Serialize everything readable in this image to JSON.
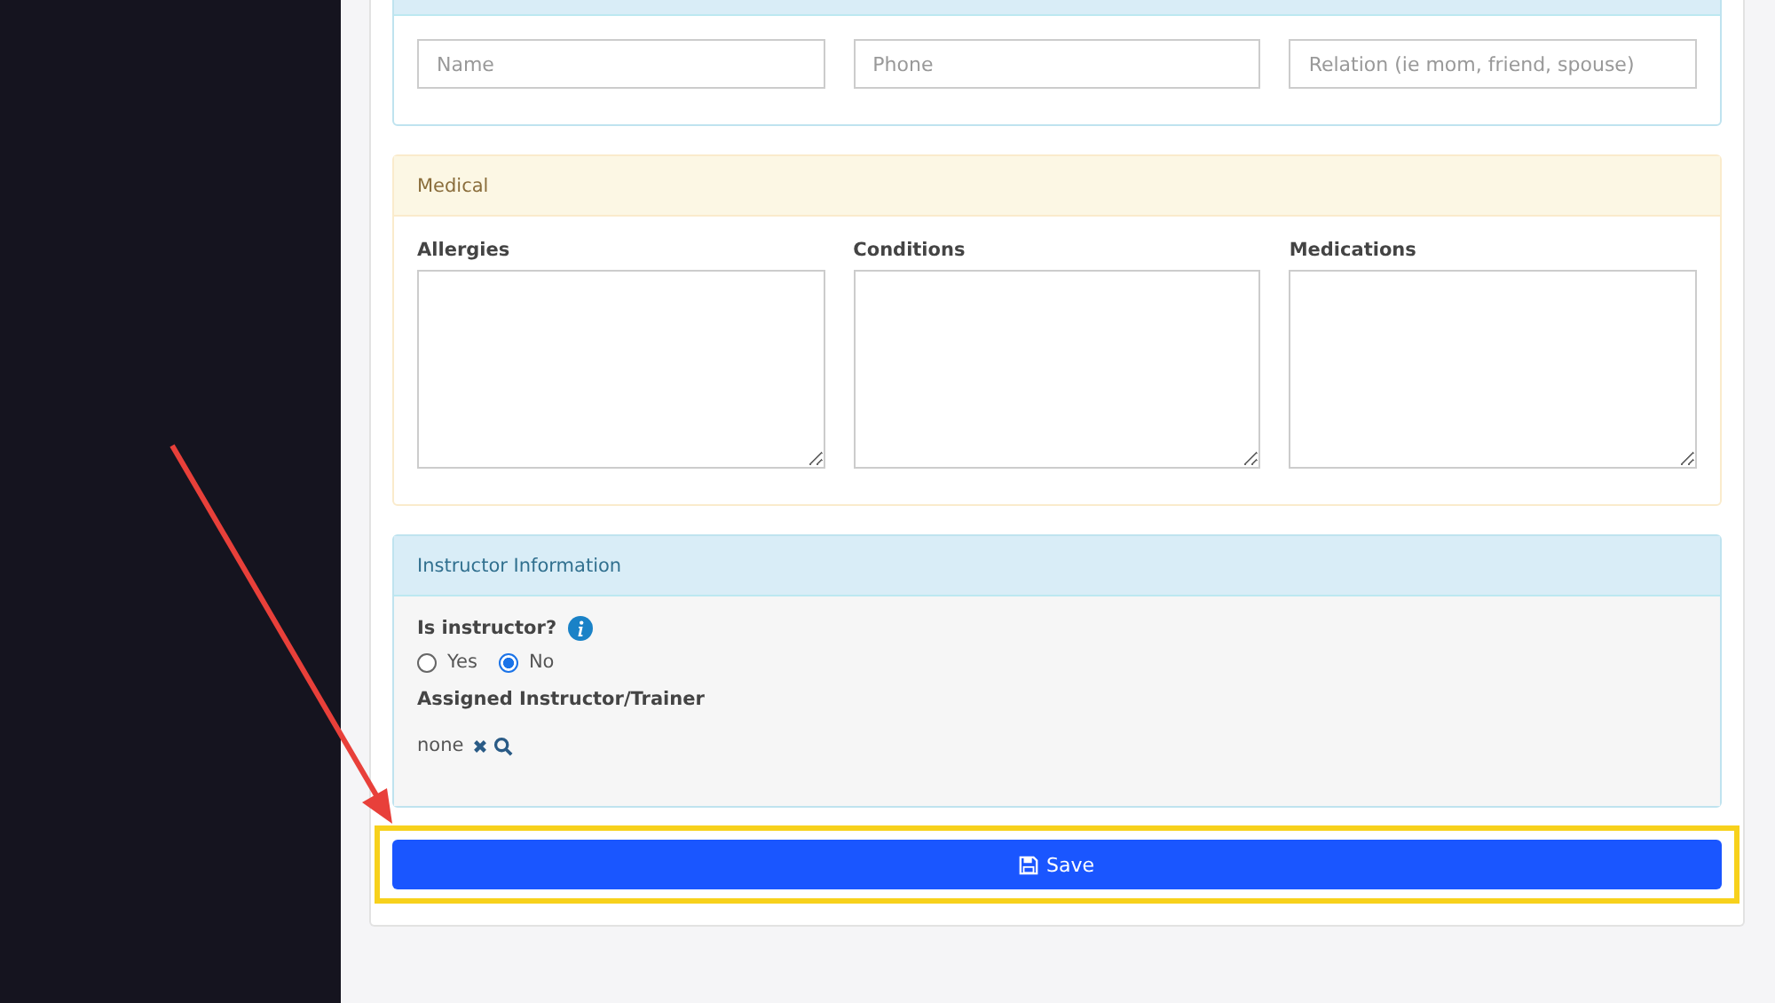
{
  "contact_panel": {
    "fields": [
      {
        "placeholder": "Name"
      },
      {
        "placeholder": "Phone"
      },
      {
        "placeholder": "Relation (ie mom, friend, spouse)"
      }
    ]
  },
  "medical_panel": {
    "title": "Medical",
    "fields": [
      {
        "label": "Allergies"
      },
      {
        "label": "Conditions"
      },
      {
        "label": "Medications"
      }
    ]
  },
  "instructor_panel": {
    "title": "Instructor Information",
    "question": "Is instructor?",
    "options": [
      {
        "label": "Yes",
        "selected": false
      },
      {
        "label": "No",
        "selected": true
      }
    ],
    "assigned_label": "Assigned Instructor/Trainer",
    "assigned_value": "none"
  },
  "save_button": {
    "label": "Save"
  }
}
